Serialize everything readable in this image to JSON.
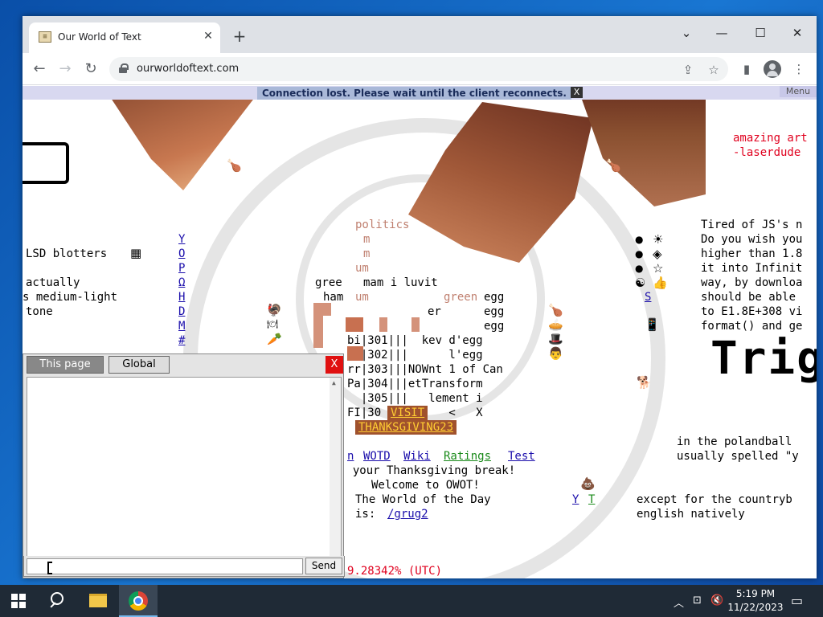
{
  "browser": {
    "tab_title": "Our World of Text",
    "tab_favicon": "scroll-icon",
    "url": "ourworldoftext.com"
  },
  "page": {
    "connection_banner": "Connection lost. Please wait until the client reconnects.",
    "connection_close": "X",
    "menu_label": "Menu",
    "text": {
      "amazing": "amazing art",
      "laserdude": "-laserdude",
      "lsd": "LSD blotters",
      "actually": "actually",
      "medium_light": "s medium-light",
      "tone": "tone",
      "vertical_links": [
        "Y",
        "O",
        "P",
        "Ω",
        "H",
        "D",
        "M",
        "#"
      ],
      "politics": "politics",
      "m1": "m",
      "m2": "m",
      "um1": "um",
      "gree": "gree",
      "mam": "mam i luvit",
      "ham": "ham",
      "um2": "um",
      "green": "green",
      "egg1": "egg",
      "er": "er",
      "egg2": "egg",
      "egg3": "egg",
      "bi301": "bi|301|||  kev d'egg",
      "r302": "  |302|||      l'egg",
      "rr303": "rr|303|||NOWnt 1 of Can",
      "pa304": "Pa|304|||etTransform",
      "r305": "  |305|||   lement i",
      "fi30": "FI|30",
      "visit": "VISIT",
      "lt_x": " <   X",
      "thanksgiving": "THANKSGIVING23",
      "n_link": "n",
      "wotd": "WOTD",
      "wiki": "Wiki",
      "ratings": "Ratings",
      "test": "Test",
      "break": "  your Thanksgiving break!",
      "welcome": "Welcome to OWOT!",
      "wotd_line": "The World of the Day",
      "is_line": "is:",
      "grug": "/grug2",
      "yt_y": "Y",
      "yt_t": "T",
      "tired": "Tired of JS's n",
      "wish": "Do you wish you",
      "higher": "higher than 1.8",
      "infinit": "it into Infinit",
      "way": "way, by downloa",
      "able": "should be able",
      "e18": "to E1.8E+308 vi",
      "format": "format() and ge",
      "trig": "Trig",
      "s_link": "S",
      "polandball": "in the polandball",
      "spelled": "usually spelled \"y",
      "except": "except for the countryb",
      "english": "english natively",
      "utc": "9.28342% (UTC)"
    }
  },
  "chat": {
    "tab_page": "This page",
    "tab_global": "Global",
    "close": "X",
    "input_value": "",
    "send": "Send"
  },
  "taskbar": {
    "time": "5:19 PM",
    "date": "11/22/2023"
  }
}
